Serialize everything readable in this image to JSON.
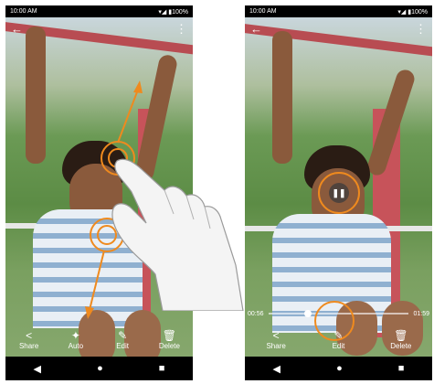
{
  "status": {
    "time": "10:00 AM",
    "battery": "100%"
  },
  "left_screen": {
    "actions": [
      {
        "icon": "share-icon",
        "glyph": "<",
        "label": "Share"
      },
      {
        "icon": "auto-enhance-icon",
        "glyph": "✦",
        "label": "Auto"
      },
      {
        "icon": "edit-pencil-icon",
        "glyph": "✎",
        "label": "Edit"
      },
      {
        "icon": "trash-icon",
        "glyph": "🗑",
        "label": "Delete"
      }
    ]
  },
  "right_screen": {
    "scrub": {
      "elapsed": "00:56",
      "remaining": "01:59",
      "progress": 0.28
    },
    "actions": [
      {
        "icon": "share-icon",
        "glyph": "<",
        "label": "Share"
      },
      {
        "icon": "edit-pencil-icon",
        "glyph": "✎",
        "label": "Edit"
      },
      {
        "icon": "trash-icon",
        "glyph": "🗑",
        "label": "Delete"
      }
    ]
  },
  "nav": {
    "back": "◀",
    "home": "●",
    "recents": "■"
  },
  "colors": {
    "accent": "#ef8a1e"
  }
}
